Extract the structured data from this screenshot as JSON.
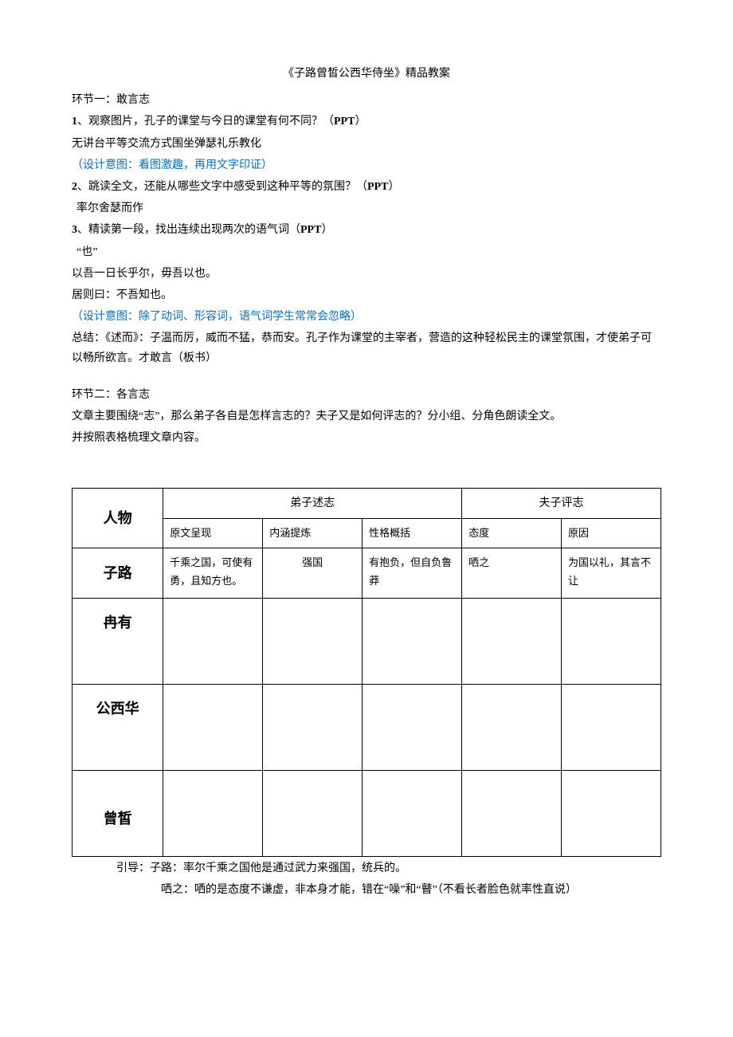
{
  "title": "《子路曾皙公西华侍坐》精品教案",
  "section1": {
    "heading": "环节一：敢言志",
    "item1_num": "1",
    "item1_text": "、观察图片，孔子的课堂与今日的课堂有何不同？（",
    "item1_ppt": "PPT",
    "item1_close": "）",
    "item1_sub": "无讲台平等交流方式围坐弹瑟礼乐教化",
    "item1_design": "（设计意图：看图激趣，再用文字印证）",
    "item2_num": "2",
    "item2_text": "、跳读全文，还能从哪些文字中感受到这种平等的氛围？（",
    "item2_ppt": "PPT",
    "item2_close": "）",
    "item2_sub": "率尔舍瑟而作",
    "item3_num": "3",
    "item3_text": "、精读第一段，找出连续出现两次的语气词（",
    "item3_ppt": "PPT",
    "item3_close": "）",
    "item3_sub1": "“也”",
    "item3_sub2": "以吾一日长乎尔，毋吾以也。",
    "item3_sub3": "居则曰：不吾知也。",
    "item3_design": "（设计意图：除了动词、形容词，语气词学生常常会忽略）",
    "summary": "总结：《述而》：子温而厉，威而不猛，恭而安。孔子作为课堂的主宰者，营造的这种轻松民主的课堂氛围，才使弟子可以畅所欲言。才敢言（板书）"
  },
  "section2": {
    "heading": "环节二：各言志",
    "intro1": "文章主要围绕“志”，那么弟子各自是怎样言志的？夫子又是如何评志的？分小组、分角色朗读全文。",
    "intro2": "并按照表格梳理文章内容。"
  },
  "table": {
    "headers": {
      "col1": "人物",
      "col2": "弟子述志",
      "col3": "夫子评志",
      "sub1": "原文呈现",
      "sub2": "内涵提炼",
      "sub3": "性格概括",
      "sub4": "态度",
      "sub5": "原因"
    },
    "rows": [
      {
        "name": "子路",
        "c1": "千乘之国，可使有勇，且知方也。",
        "c2": "强国",
        "c3": "有抱负，但自负鲁莽",
        "c4": "哂之",
        "c5": "为国以礼，其言不让"
      },
      {
        "name": "冉有",
        "c1": "",
        "c2": "",
        "c3": "",
        "c4": "",
        "c5": ""
      },
      {
        "name": "公西华",
        "c1": "",
        "c2": "",
        "c3": "",
        "c4": "",
        "c5": ""
      },
      {
        "name": "曾皙",
        "c1": "",
        "c2": "",
        "c3": "",
        "c4": "",
        "c5": ""
      }
    ]
  },
  "footer": {
    "line1": "引导：子路：率尔千乘之国他是通过武力来强国，统兵的。",
    "line2": "哂之：哂的是态度不谦虚，非本身才能，错在“噪”和“瞽”（不看长者脸色就率性直说）"
  }
}
